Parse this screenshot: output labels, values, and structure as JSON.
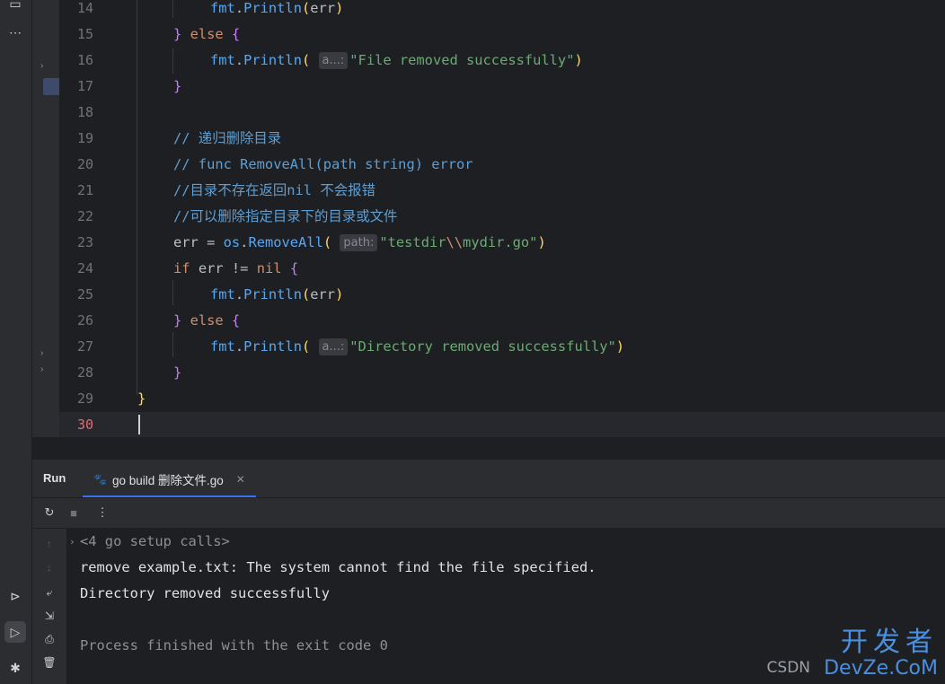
{
  "editor": {
    "lines": [
      {
        "num": "14"
      },
      {
        "num": "15"
      },
      {
        "num": "16"
      },
      {
        "num": "17"
      },
      {
        "num": "18"
      },
      {
        "num": "19"
      },
      {
        "num": "20"
      },
      {
        "num": "21"
      },
      {
        "num": "22"
      },
      {
        "num": "23"
      },
      {
        "num": "24"
      },
      {
        "num": "25"
      },
      {
        "num": "26"
      },
      {
        "num": "27"
      },
      {
        "num": "28"
      },
      {
        "num": "29"
      },
      {
        "num": "30"
      }
    ],
    "tokens": {
      "fmt": "fmt",
      "println": "Println",
      "err": "err",
      "else": "else",
      "if": "if",
      "hint_a": "a...:",
      "hint_path": "path:",
      "str_file": "\"File removed successfully\"",
      "comment_19": "// 递归删除目录",
      "comment_20": "// func RemoveAll(path string) error",
      "comment_21": "//目录不存在返回nil 不会报错",
      "comment_22": "//可以删除指定目录下的目录或文件",
      "os": "os",
      "removeall": "RemoveAll",
      "str_dir_path_a": "\"testdir",
      "str_dir_path_esc": "\\\\",
      "str_dir_path_b": "mydir.go\"",
      "nil": "nil",
      "str_dir": "\"Directory removed successfully\""
    }
  },
  "run": {
    "title": "Run",
    "tab_label": "go build 删除文件.go",
    "console": [
      "<4 go setup calls>",
      "remove example.txt: The system cannot find the file specified.",
      "Directory removed successfully",
      "",
      "Process finished with the exit code 0"
    ]
  },
  "watermark": {
    "csdn": "CSDN",
    "cn": "开发者",
    "en": "DevZe.CoM"
  }
}
